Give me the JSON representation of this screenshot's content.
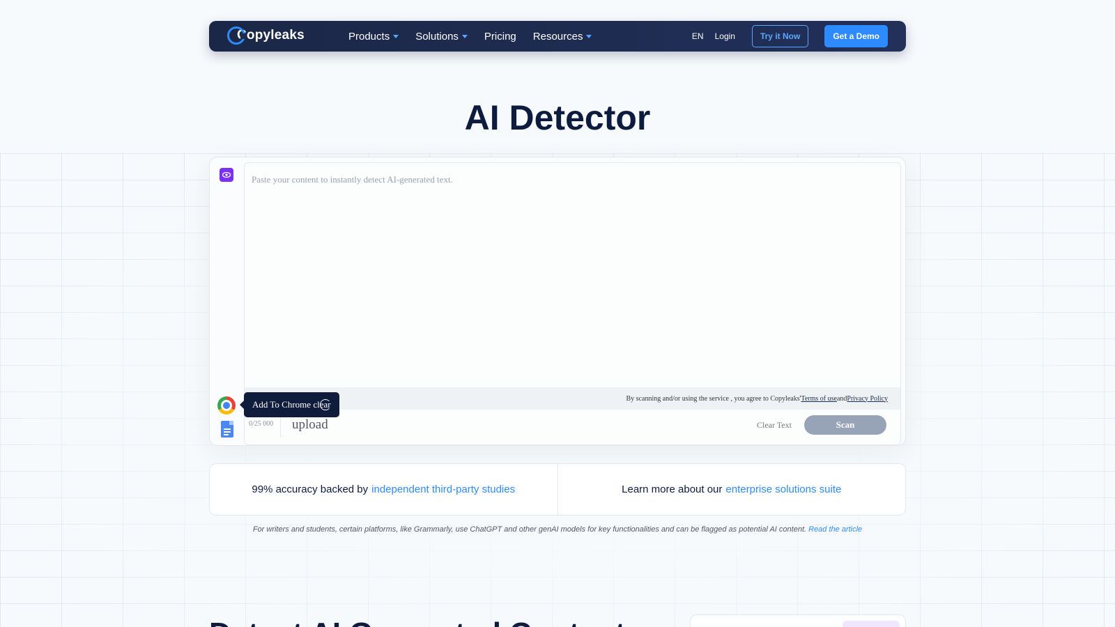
{
  "nav": {
    "logo_text": "Copyleaks",
    "items": [
      {
        "label": "Products",
        "has_dropdown": true
      },
      {
        "label": "Solutions",
        "has_dropdown": true
      },
      {
        "label": "Pricing",
        "has_dropdown": false
      },
      {
        "label": "Resources",
        "has_dropdown": true
      }
    ],
    "lang": "EN",
    "login": "Login",
    "try_button": "Try it Now",
    "demo_button": "Get a Demo"
  },
  "page": {
    "title": "AI Detector"
  },
  "editor": {
    "placeholder": "Paste your content to instantly detect AI-generated text.",
    "terms_prefix": "By scanning and/or using the service , you agree to Copyleaks' ",
    "terms_link": "Terms of use ",
    "terms_and": "and ",
    "privacy_link": "Privacy Policy",
    "counter": "0/25 000",
    "upload_label": "upload",
    "clear_label": "Clear Text",
    "scan_label": "Scan",
    "tooltip": "Add To Chrome clear"
  },
  "info": {
    "left_text": "99% accuracy backed by",
    "left_link": "independent third-party studies",
    "right_text": "Learn more about our",
    "right_link": "enterprise solutions suite"
  },
  "disclaimer": {
    "text": "For writers and students, certain platforms, like Grammarly, use ChatGPT and other genAI models for key functionalities and can be flagged as potential AI content. ",
    "link": "Read the article"
  },
  "next_section": {
    "heading": "Detect AI Generated Content"
  },
  "colors": {
    "brand_blue": "#2e8bff",
    "nav_bg": "#1b2747",
    "accent_purple": "#7b2ff7",
    "scan_disabled": "#97a3b6"
  }
}
